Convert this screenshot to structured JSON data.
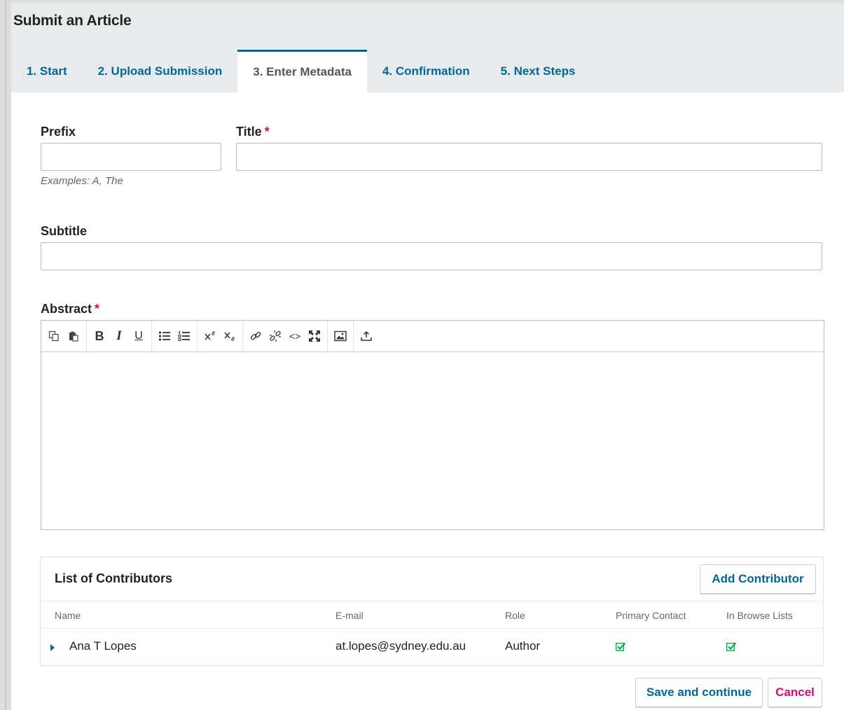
{
  "header": {
    "title": "Submit an Article"
  },
  "tabs": [
    {
      "label": "1. Start"
    },
    {
      "label": "2. Upload Submission"
    },
    {
      "label": "3. Enter Metadata",
      "active": true
    },
    {
      "label": "4. Confirmation"
    },
    {
      "label": "5. Next Steps"
    }
  ],
  "form": {
    "prefix": {
      "label": "Prefix",
      "value": "",
      "hint": "Examples: A, The"
    },
    "title": {
      "label": "Title",
      "required_mark": "*",
      "value": ""
    },
    "subtitle": {
      "label": "Subtitle",
      "value": ""
    },
    "abstract": {
      "label": "Abstract",
      "required_mark": "*",
      "toolbar_icons": [
        "copy-icon",
        "paste-icon",
        "bold-icon",
        "italic-icon",
        "underline-icon",
        "bullet-list-icon",
        "numbered-list-icon",
        "superscript-icon",
        "subscript-icon",
        "link-icon",
        "unlink-icon",
        "code-icon",
        "fullscreen-icon",
        "image-icon",
        "upload-icon"
      ],
      "toolbar_text": {
        "bold": "B",
        "italic": "I",
        "underline": "U",
        "code": "<>"
      }
    }
  },
  "contributors": {
    "title": "List of Contributors",
    "add_label": "Add Contributor",
    "columns": [
      "Name",
      "E-mail",
      "Role",
      "Primary Contact",
      "In Browse Lists"
    ],
    "rows": [
      {
        "name": "Ana T Lopes",
        "email": "at.lopes@sydney.edu.au",
        "role": "Author",
        "primary_contact": true,
        "in_browse_lists": true
      }
    ]
  },
  "actions": {
    "save_label": "Save and continue",
    "cancel_label": "Cancel"
  },
  "colors": {
    "accent": "#006798",
    "required": "#d00a6c",
    "check": "#00b24e",
    "header_bg": "#e8ebec"
  }
}
